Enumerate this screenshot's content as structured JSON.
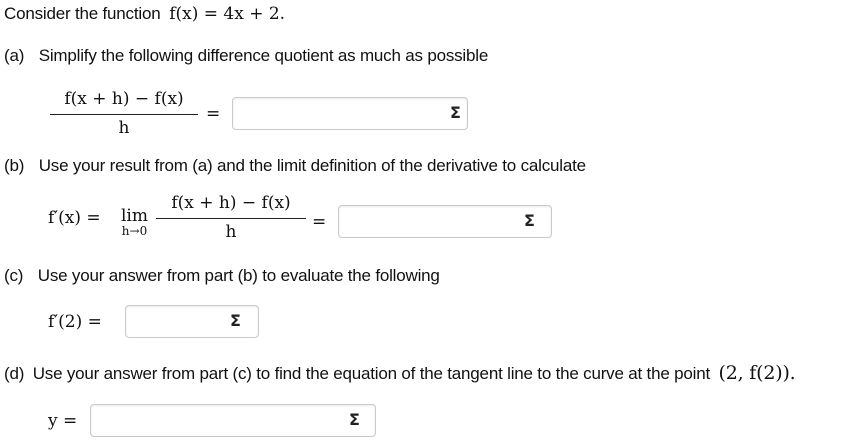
{
  "intro": {
    "text": "Consider the function",
    "function_expr": "f(x) = 4x + 2."
  },
  "parts": {
    "a": {
      "label": "(a)",
      "text": "Simplify the following difference quotient as much as possible",
      "numerator": "f(x + h) − f(x)",
      "denominator": "h",
      "equals": "=",
      "answer_value": "",
      "sigma_icon": "Σ"
    },
    "b": {
      "label": "(b)",
      "text": "Use your result from (a) and the limit definition of the derivative to calculate",
      "lhs": "f′(x) =",
      "lim": "lim",
      "lim_sub": "h→0",
      "numerator": "f(x + h) − f(x)",
      "denominator": "h",
      "equals": "=",
      "answer_value": "",
      "sigma_icon": "Σ"
    },
    "c": {
      "label": "(c)",
      "text": "Use your answer from part (b) to evaluate the following",
      "lhs": "f′(2) =",
      "answer_value": "",
      "sigma_icon": "Σ"
    },
    "d": {
      "label": "(d)",
      "text": "Use your answer from part (c) to find the equation of the tangent line to the curve at the point",
      "point": "(2, f(2)).",
      "lhs": "y =",
      "answer_value": "",
      "sigma_icon": "Σ"
    }
  }
}
